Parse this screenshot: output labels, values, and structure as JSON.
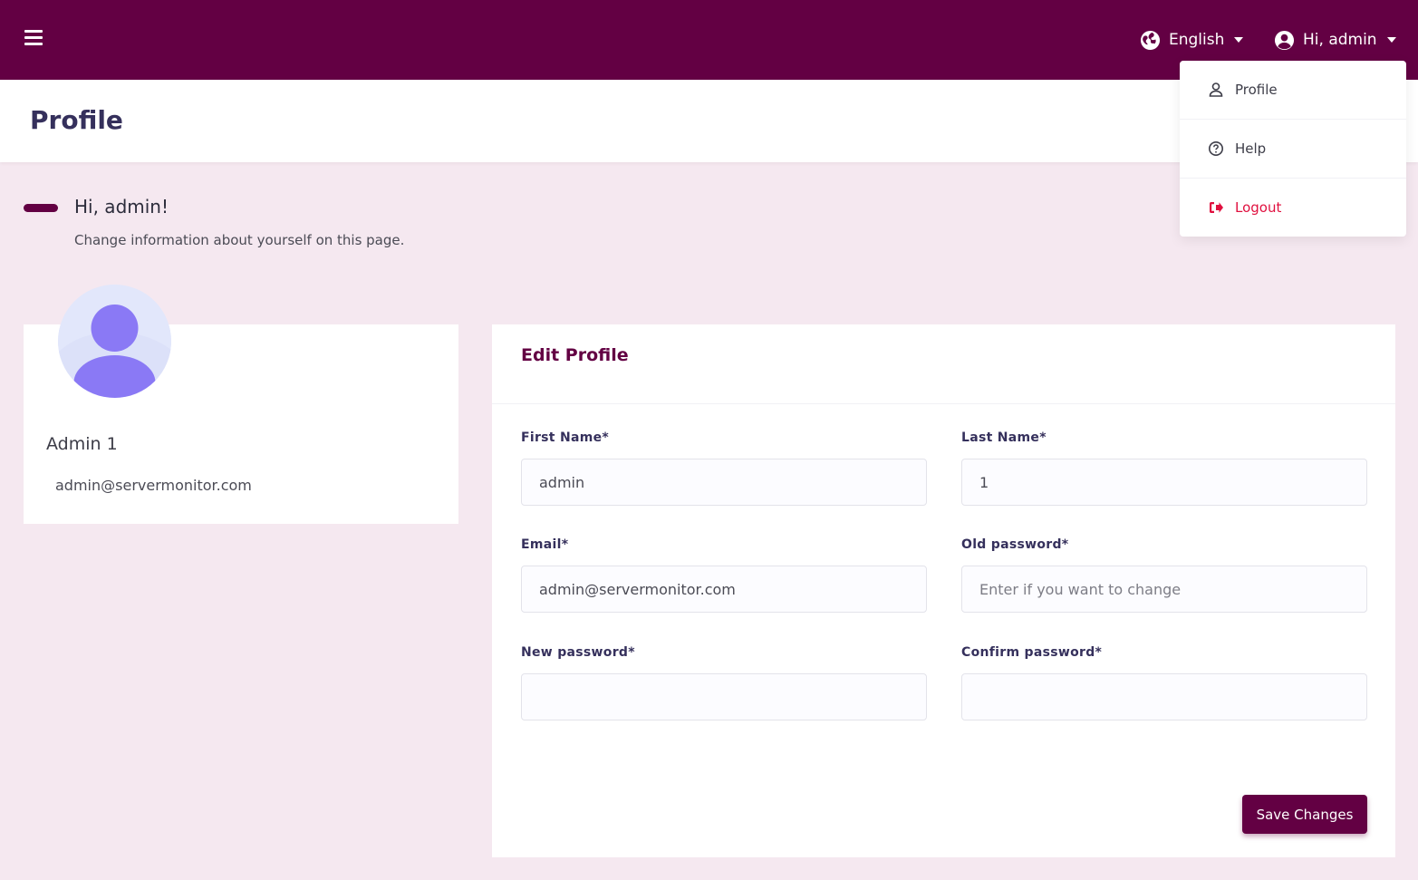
{
  "topbar": {
    "language": "English",
    "user_greeting": "Hi, admin"
  },
  "header": {
    "title": "Profile"
  },
  "welcome": {
    "greeting": "Hi, admin!",
    "subtitle": "Change information about yourself on this page."
  },
  "profile_card": {
    "name": "Admin 1",
    "email": "admin@servermonitor.com"
  },
  "edit_form": {
    "title": "Edit Profile",
    "first_name": {
      "label": "First Name*",
      "value": "admin"
    },
    "last_name": {
      "label": "Last Name*",
      "value": "1"
    },
    "email": {
      "label": "Email*",
      "value": "admin@servermonitor.com"
    },
    "old_password": {
      "label": "Old password*",
      "value": "",
      "placeholder": "Enter if you want to change"
    },
    "new_password": {
      "label": "New password*",
      "value": ""
    },
    "confirm_password": {
      "label": "Confirm password*",
      "value": ""
    },
    "save_label": "Save Changes"
  },
  "user_menu": {
    "items": [
      {
        "label": "Profile",
        "icon": "user-icon"
      },
      {
        "label": "Help",
        "icon": "question-circle-icon"
      },
      {
        "label": "Logout",
        "icon": "logout-icon"
      }
    ]
  },
  "colors": {
    "brand": "#630043",
    "page_background": "#f5e8f0",
    "title_text": "#35305c",
    "logout": "#e0103f",
    "avatar": "#8a79f5"
  }
}
